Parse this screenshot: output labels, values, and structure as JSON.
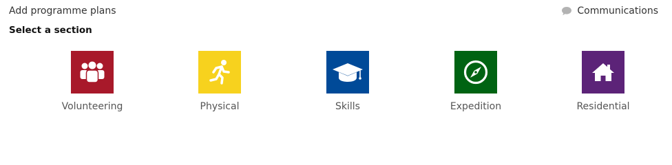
{
  "header": {
    "title": "Add programme plans",
    "communications_label": "Communications",
    "communications_icon": "speech-bubble-icon"
  },
  "section_heading": "Select a section",
  "sections": [
    {
      "label": "Volunteering",
      "icon": "people-group-icon",
      "color": "#a8192a"
    },
    {
      "label": "Physical",
      "icon": "running-person-icon",
      "color": "#f7d21e"
    },
    {
      "label": "Skills",
      "icon": "graduation-cap-icon",
      "color": "#004a98"
    },
    {
      "label": "Expedition",
      "icon": "compass-icon",
      "color": "#006312"
    },
    {
      "label": "Residential",
      "icon": "house-icon",
      "color": "#5c2378"
    }
  ]
}
